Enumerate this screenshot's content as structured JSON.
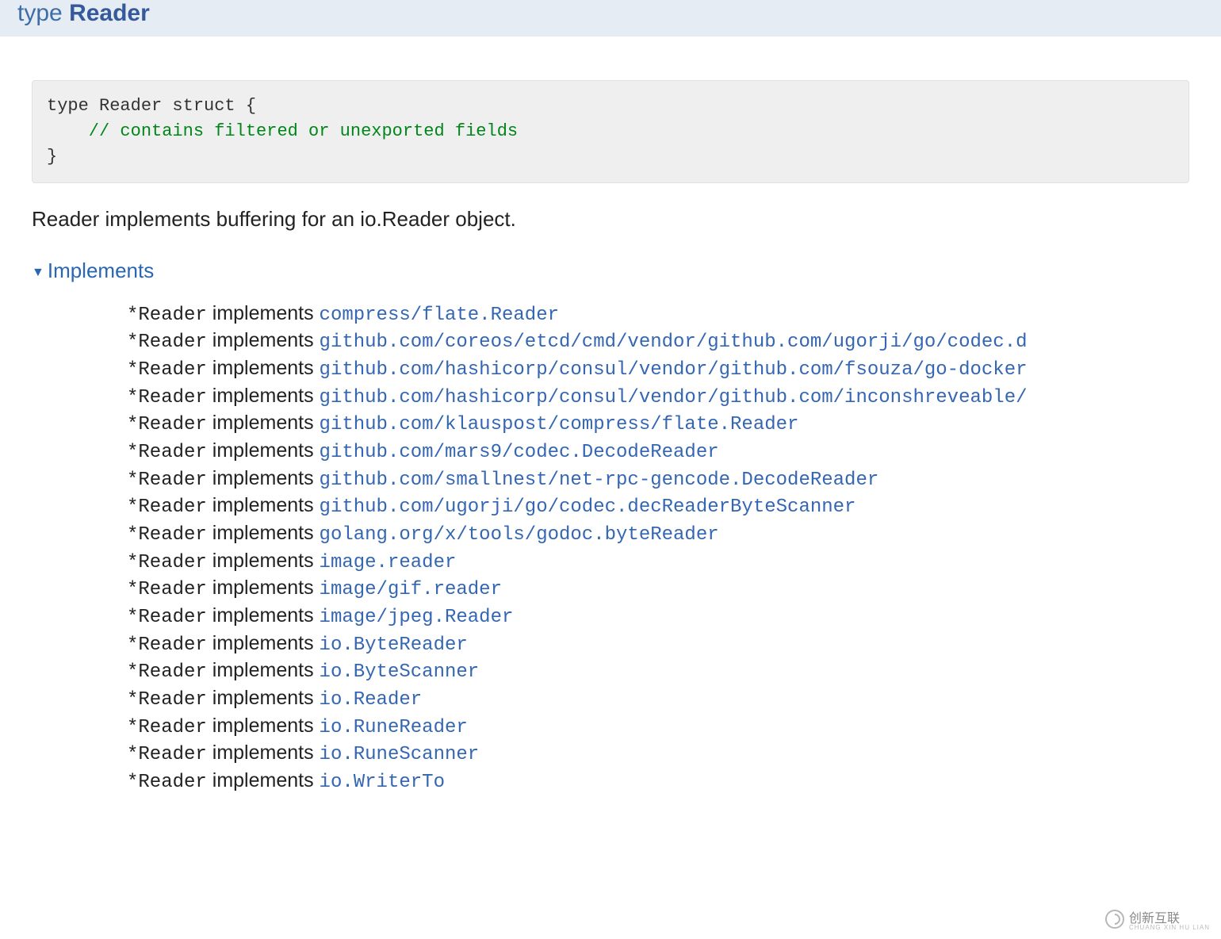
{
  "header": {
    "type_kw": "type",
    "type_name": "Reader"
  },
  "code": {
    "line1": "type Reader struct {",
    "comment": "    // contains filtered or unexported fields",
    "line3": "}"
  },
  "description": "Reader implements buffering for an io.Reader object.",
  "implements_label": "Implements",
  "impl_prefix": "*Reader",
  "impl_word": "implements",
  "implements": [
    "compress/flate.Reader",
    "github.com/coreos/etcd/cmd/vendor/github.com/ugorji/go/codec.d",
    "github.com/hashicorp/consul/vendor/github.com/fsouza/go-docker",
    "github.com/hashicorp/consul/vendor/github.com/inconshreveable/",
    "github.com/klauspost/compress/flate.Reader",
    "github.com/mars9/codec.DecodeReader",
    "github.com/smallnest/net-rpc-gencode.DecodeReader",
    "github.com/ugorji/go/codec.decReaderByteScanner",
    "golang.org/x/tools/godoc.byteReader",
    "image.reader",
    "image/gif.reader",
    "image/jpeg.Reader",
    "io.ByteReader",
    "io.ByteScanner",
    "io.Reader",
    "io.RuneReader",
    "io.RuneScanner",
    "io.WriterTo"
  ],
  "watermark": {
    "main": "创新互联",
    "sub": "CHUANG XIN HU LIAN"
  }
}
